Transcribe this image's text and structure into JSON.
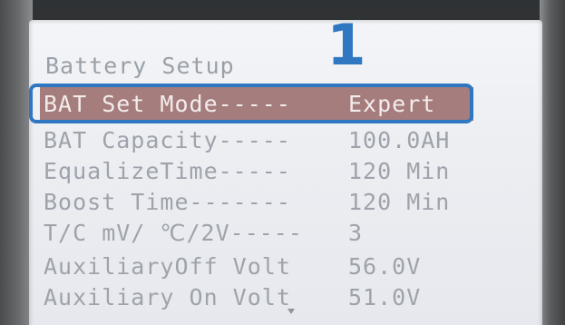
{
  "screen": {
    "title": "Battery Setup",
    "annotation_number": "1",
    "rows": [
      {
        "label": "BAT Set Mode-----",
        "value": "Expert",
        "selected": true
      },
      {
        "label": "BAT Capacity-----",
        "value": "100.0AH",
        "selected": false
      },
      {
        "label": "EqualizeTime-----",
        "value": "120 Min",
        "selected": false
      },
      {
        "label": "Boost Time-------",
        "value": "120 Min",
        "selected": false
      },
      {
        "label": "T/C mV/ ℃/2V-----",
        "value": "3",
        "selected": false
      },
      {
        "label": "AuxiliaryOff Volt",
        "value": "56.0V",
        "selected": false
      },
      {
        "label": "Auxiliary On Volt",
        "value": "51.0V",
        "selected": false
      }
    ]
  },
  "icons": {
    "scroll": "scroll-down-arrow-icon"
  },
  "colors": {
    "highlight_outline": "#2f77c0",
    "selected_row_bg": "#a47d7c",
    "lcd_text": "#9ea3ab",
    "lcd_bg": "#eceef2"
  }
}
